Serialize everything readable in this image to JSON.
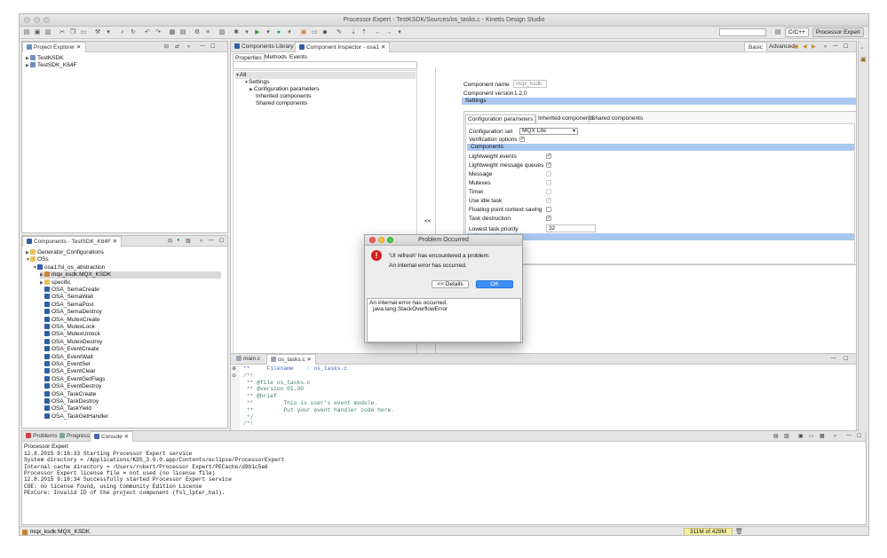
{
  "window": {
    "title": "Processor Expert - TestKSDK/Sources/os_tasks.c - Kinetis Design Studio"
  },
  "toolbar": {
    "perspective_cc": "C/C++",
    "perspective_pe": "Processor Expert"
  },
  "project_explorer": {
    "tab": "Project Explorer",
    "items": [
      "TestKSDK",
      "TestSDK_K64F"
    ]
  },
  "components_view": {
    "tab": "Components - TestSDK_K64F",
    "tree": [
      {
        "label": "Generator_Configurations",
        "icon": "folder-icon",
        "depth": 0,
        "expanded": false
      },
      {
        "label": "OSs",
        "icon": "folder-icon",
        "depth": 0,
        "expanded": true
      },
      {
        "label": "osa1:fsl_os_abstraction",
        "icon": "component-icon",
        "depth": 1,
        "expanded": true
      },
      {
        "label": "mqx_ksdk:MQX_KSDK",
        "icon": "ksdk-icon",
        "depth": 2,
        "expanded": false,
        "selected": true
      },
      {
        "label": "specific",
        "icon": "folder-icon",
        "depth": 2,
        "expanded": false
      },
      {
        "label": "OSA_SemaCreate",
        "icon": "method-icon",
        "depth": 2
      },
      {
        "label": "OSA_SemaWait",
        "icon": "method-icon",
        "depth": 2
      },
      {
        "label": "OSA_SemaPost",
        "icon": "method-icon",
        "depth": 2
      },
      {
        "label": "OSA_SemaDestroy",
        "icon": "method-icon",
        "depth": 2
      },
      {
        "label": "OSA_MutexCreate",
        "icon": "method-icon",
        "depth": 2
      },
      {
        "label": "OSA_MutexLock",
        "icon": "method-icon",
        "depth": 2
      },
      {
        "label": "OSA_MutexUnlock",
        "icon": "method-icon",
        "depth": 2
      },
      {
        "label": "OSA_MutexDestroy",
        "icon": "method-icon",
        "depth": 2
      },
      {
        "label": "OSA_EventCreate",
        "icon": "method-icon",
        "depth": 2
      },
      {
        "label": "OSA_EventWait",
        "icon": "method-icon",
        "depth": 2
      },
      {
        "label": "OSA_EventSet",
        "icon": "method-icon",
        "depth": 2
      },
      {
        "label": "OSA_EventClear",
        "icon": "method-icon",
        "depth": 2
      },
      {
        "label": "OSA_EventGetFlags",
        "icon": "method-icon",
        "depth": 2
      },
      {
        "label": "OSA_EventDestroy",
        "icon": "method-icon",
        "depth": 2
      },
      {
        "label": "OSA_TaskCreate",
        "icon": "method-icon",
        "depth": 2
      },
      {
        "label": "OSA_TaskDestroy",
        "icon": "method-icon",
        "depth": 2
      },
      {
        "label": "OSA_TaskYield",
        "icon": "method-icon",
        "depth": 2
      },
      {
        "label": "OSA_TaskGetHandler",
        "icon": "method-icon",
        "depth": 2
      }
    ]
  },
  "inspector": {
    "tabs": [
      "Components Library",
      "Component Inspector - osa1"
    ],
    "subtabs": [
      "Properties",
      "Methods",
      "Events"
    ],
    "modes": [
      "Basic",
      "Advanced"
    ],
    "tree": [
      "All",
      "Settings",
      "Configuration parameters",
      "Inherited components",
      "Shared components"
    ],
    "collapse_label": "<<",
    "component_name_label": "Component name",
    "component_name_value": "mqx_ksdk",
    "component_version_label": "Component version",
    "component_version_value": "1.2.0",
    "settings_header": "Settings",
    "inner_tabs": [
      "Configuration parameters",
      "Inherited components",
      "Shared components"
    ],
    "config_set_label": "Configuration set",
    "config_set_value": "MQX Lite",
    "verification_label": "Verification options",
    "components_header": "Components",
    "options": [
      {
        "label": "Lightweight events",
        "checked": true,
        "enabled": true
      },
      {
        "label": "Lightweight message queues",
        "checked": true,
        "enabled": true
      },
      {
        "label": "Message",
        "checked": false,
        "enabled": false
      },
      {
        "label": "Mutexes",
        "checked": false,
        "enabled": false
      },
      {
        "label": "Timer",
        "checked": false,
        "enabled": false
      },
      {
        "label": "Use idle task",
        "checked": true,
        "enabled": false
      },
      {
        "label": "Floating point context saving",
        "checked": false,
        "enabled": true
      },
      {
        "label": "Task destruction",
        "checked": true,
        "enabled": true
      }
    ],
    "lowest_priority_label": "Lowest task priority",
    "lowest_priority_value": "32",
    "user_settings_header": "User settings"
  },
  "editor": {
    "tabs": [
      "main.c",
      "os_tasks.c"
    ],
    "lines": [
      "**     Filename    : os_tasks.c",
      "/*!",
      " ** @file os_tasks.c",
      " ** @version 01.00",
      " ** @brief",
      " **         This is user's event module.",
      " **         Put your event handler code here.",
      " */",
      "/*!"
    ]
  },
  "console": {
    "tabs": [
      "Problems",
      "Progress",
      "Console"
    ],
    "title": "Processor Expert",
    "lines": [
      "12.8.2015 9:18:33 Starting Processor Expert service",
      "System directory = /Applications/KDS_3.0.0.app/Contents/eclipse/ProcessorExpert",
      "Internal cache directory = /Users/robert/Processor Expert/PECache/d9b1c5a6",
      "Processor Expert license file = not used (no license file)",
      "12.8.2015 9:18:34 Successfully started Processor Expert service",
      "CDE: no license found, using Community Edition License",
      "PExCore: Invalid ID of the project component (fsl_lpter_hal)."
    ]
  },
  "statusbar": {
    "selection": "mqx_ksdk:MQX_KSDK",
    "memory": "311M of 429M"
  },
  "dialog": {
    "title": "Problem Occurred",
    "message": "'UI refresh' has encountered a problem.",
    "sub": "An internal error has occurred.",
    "details_button": "<< Details",
    "ok_button": "OK",
    "details": [
      "An internal error has occurred.",
      "java.lang.StackOverflowError"
    ]
  },
  "colors": {
    "selection": "#a9c8ef",
    "ok_button": "#3d8ef5",
    "error_icon": "#d21f1f"
  }
}
